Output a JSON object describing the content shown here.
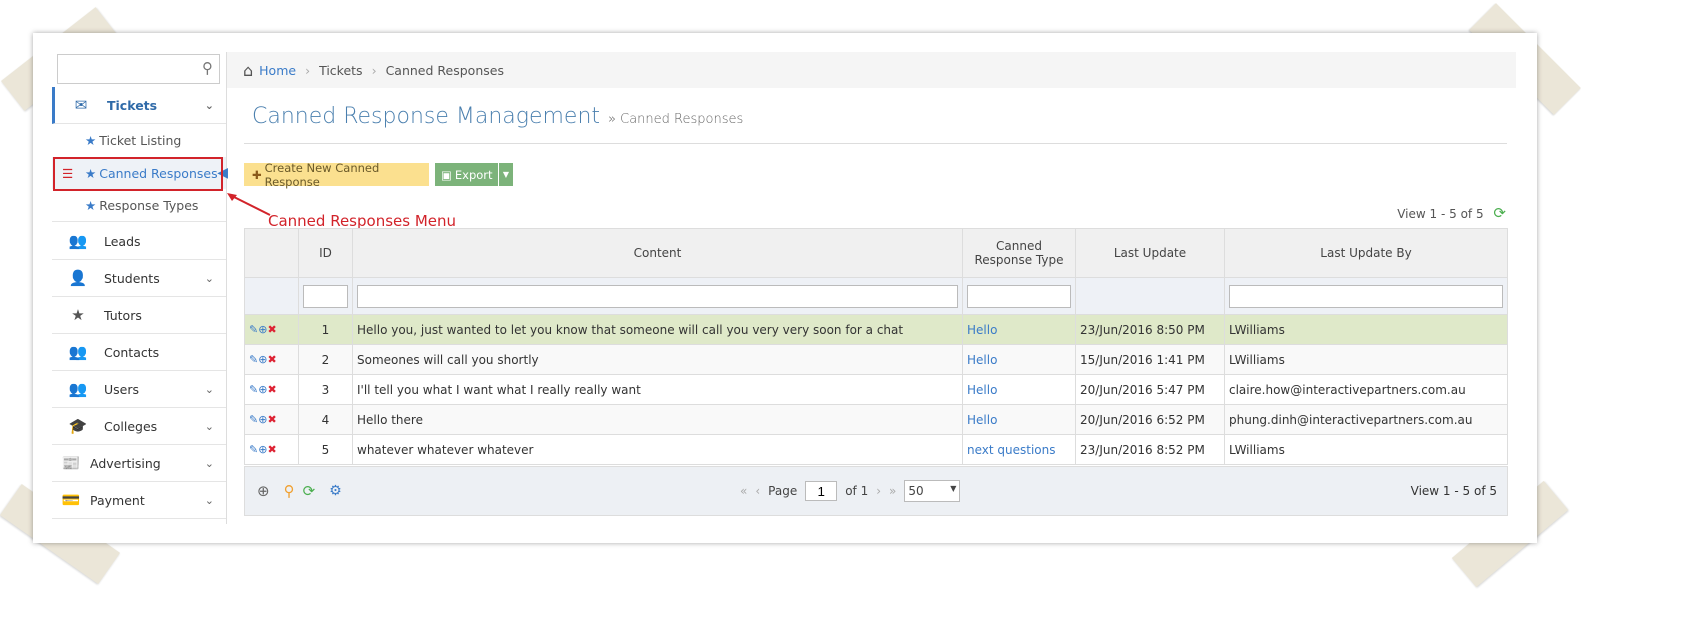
{
  "sidebar": {
    "search_placeholder": "",
    "items": [
      {
        "label": "Tickets",
        "icon": "envelope-icon"
      },
      {
        "label": "Leads",
        "icon": "users-icon"
      },
      {
        "label": "Students",
        "icon": "user-icon"
      },
      {
        "label": "Tutors",
        "icon": "star-icon"
      },
      {
        "label": "Contacts",
        "icon": "users-icon"
      },
      {
        "label": "Users",
        "icon": "users-icon"
      },
      {
        "label": "Colleges",
        "icon": "graduation-cap-icon"
      },
      {
        "label": "Advertising",
        "icon": "newspaper-icon"
      },
      {
        "label": "Payment",
        "icon": "card-icon"
      }
    ],
    "subitems": [
      "Ticket Listing",
      "Canned Responses",
      "Response Types"
    ]
  },
  "breadcrumb": [
    "Home",
    "Tickets",
    "Canned Responses"
  ],
  "page": {
    "title": "Canned Response Management",
    "subtitle": "» Canned Responses"
  },
  "toolbar": {
    "create": "Create New Canned Response",
    "export": "Export"
  },
  "annotation": "Canned Responses Menu",
  "grid": {
    "view_top": "View 1 - 5 of 5",
    "columns": [
      "ID",
      "Content",
      "Canned Response Type",
      "Last Update",
      "Last Update By"
    ],
    "rows": [
      [
        "1",
        "Hello you, just wanted to let you know that someone will call you very very soon for a chat",
        "Hello",
        "23/Jun/2016 8:50 PM",
        "LWilliams"
      ],
      [
        "2",
        "Someones will call you shortly",
        "Hello",
        "15/Jun/2016 1:41 PM",
        "LWilliams"
      ],
      [
        "3",
        "I'll tell you what I want what I really really want",
        "Hello",
        "20/Jun/2016 5:47 PM",
        "claire.how@interactivepartners.com.au"
      ],
      [
        "4",
        "Hello there",
        "Hello",
        "20/Jun/2016 6:52 PM",
        "phung.dinh@interactivepartners.com.au"
      ],
      [
        "5",
        "whatever whatever whatever",
        "next questions",
        "23/Jun/2016 8:52 PM",
        "LWilliams"
      ]
    ],
    "pager": {
      "page_label": "Page",
      "page": "1",
      "of": "of 1",
      "page_size": "50",
      "view": "View 1 - 5 of 5"
    }
  },
  "colors": {
    "accent": "#3a7bc8",
    "highlight": "#d2232a",
    "selected_row": "#dfe9c9"
  }
}
